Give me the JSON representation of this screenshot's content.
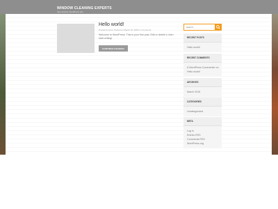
{
  "header": {
    "title": "WINDOW CLEANING EXPERTS",
    "tagline": "Just another WordPress site"
  },
  "post": {
    "title": "Hello world!",
    "meta": "Posted by Heri  |  Posted on March 19, 2018  |  1 Comment",
    "excerpt": "Welcome to WordPress. This is your first post. Edit or delete it, then start writing!",
    "read_more": "CONTINUE READING"
  },
  "search": {
    "placeholder": "Search...",
    "icon": "search-icon"
  },
  "widgets": {
    "recent_posts": {
      "title": "RECENT POSTS",
      "items": [
        "Hello world!"
      ]
    },
    "recent_comments": {
      "title": "RECENT COMMENTS",
      "line1": "A WordPress Commenter on",
      "line2": "Hello world!"
    },
    "archives": {
      "title": "ARCHIVES",
      "items": [
        "March 2018"
      ]
    },
    "categories": {
      "title": "CATEGORIES",
      "items": [
        "Uncategorized"
      ]
    },
    "meta": {
      "title": "META",
      "items": [
        "Log in",
        "Entries RSS",
        "Comments RSS",
        "WordPress.org"
      ]
    }
  },
  "colors": {
    "accent": "#f39a1d",
    "header_bg": "#8e8e8e",
    "button_bg": "#9a9a9a"
  }
}
